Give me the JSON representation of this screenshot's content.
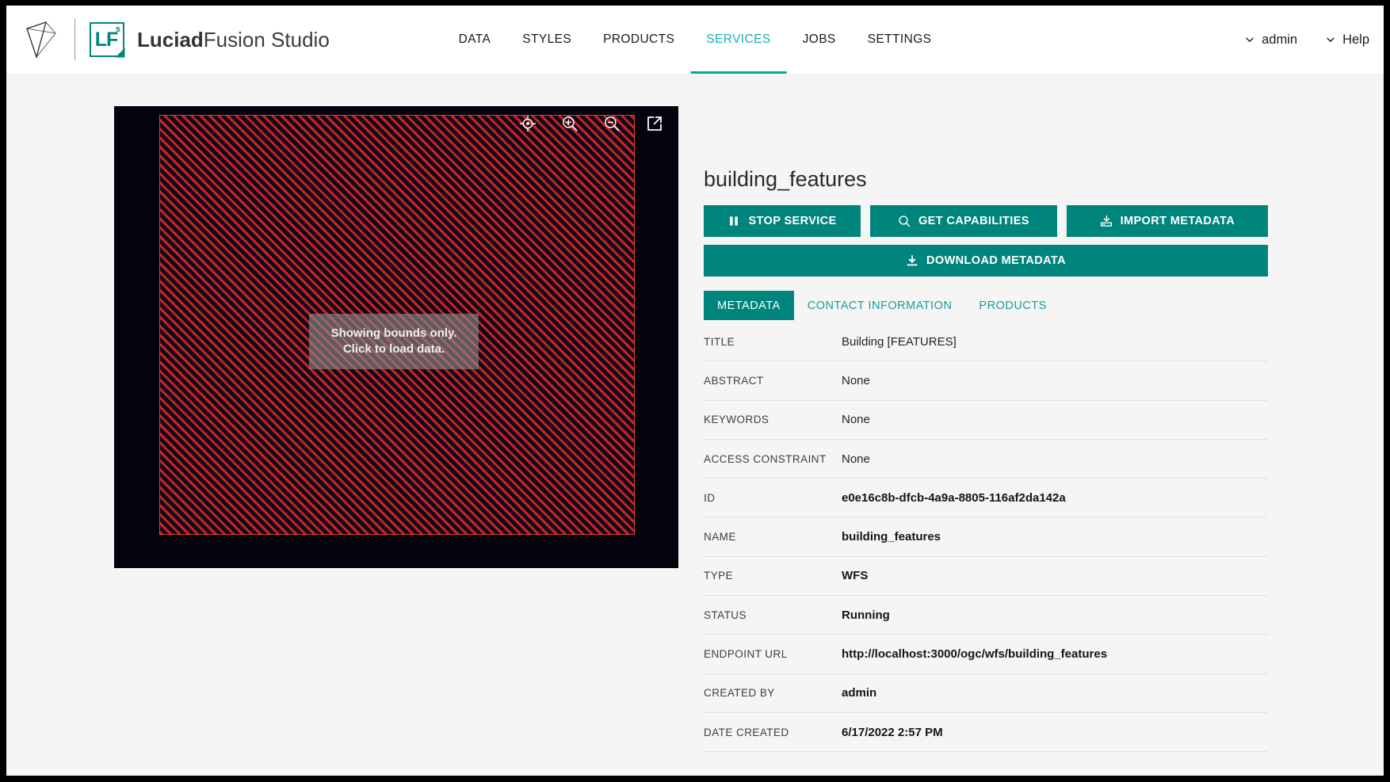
{
  "header": {
    "brand_prefix": "Luciad",
    "brand_suffix": "Fusion Studio",
    "logo_mark": "luciad-mark-icon",
    "badge_text": "LF",
    "badge_sup": "s",
    "nav": [
      {
        "label": "DATA",
        "active": false
      },
      {
        "label": "STYLES",
        "active": false
      },
      {
        "label": "PRODUCTS",
        "active": false
      },
      {
        "label": "SERVICES",
        "active": true
      },
      {
        "label": "JOBS",
        "active": false
      },
      {
        "label": "SETTINGS",
        "active": false
      }
    ],
    "user_menu": "admin",
    "help_menu": "Help"
  },
  "map": {
    "overlay_line1": "Showing bounds only.",
    "overlay_line2": "Click to load data.",
    "tools": [
      {
        "name": "fit-bounds-icon"
      },
      {
        "name": "zoom-in-icon"
      },
      {
        "name": "zoom-out-icon"
      },
      {
        "name": "open-external-icon"
      }
    ],
    "background_color": "#02030d",
    "bounds_stroke_color": "#e23b3b",
    "hatch_color": "#d32020"
  },
  "details": {
    "title": "building_features",
    "buttons": {
      "stop_service": "STOP SERVICE",
      "get_capabilities": "GET CAPABILITIES",
      "import_metadata": "IMPORT METADATA",
      "download_metadata": "DOWNLOAD METADATA"
    },
    "tabs": [
      {
        "label": "METADATA",
        "active": true
      },
      {
        "label": "CONTACT INFORMATION",
        "active": false
      },
      {
        "label": "PRODUCTS",
        "active": false
      }
    ],
    "metadata": [
      {
        "key": "TITLE",
        "value": "Building [FEATURES]",
        "bold": false
      },
      {
        "key": "ABSTRACT",
        "value": "None",
        "bold": false
      },
      {
        "key": "KEYWORDS",
        "value": "None",
        "bold": false
      },
      {
        "key": "ACCESS CONSTRAINT",
        "value": "None",
        "bold": false
      },
      {
        "key": "ID",
        "value": "e0e16c8b-dfcb-4a9a-8805-116af2da142a",
        "bold": true
      },
      {
        "key": "NAME",
        "value": "building_features",
        "bold": true
      },
      {
        "key": "TYPE",
        "value": "WFS",
        "bold": true
      },
      {
        "key": "STATUS",
        "value": "Running",
        "bold": true
      },
      {
        "key": "ENDPOINT URL",
        "value": "http://localhost:3000/ogc/wfs/building_features",
        "bold": true
      },
      {
        "key": "CREATED BY",
        "value": "admin",
        "bold": true
      },
      {
        "key": "DATE CREATED",
        "value": "6/17/2022 2:57 PM",
        "bold": true
      }
    ]
  },
  "colors": {
    "teal": "#00857d",
    "teal_accent": "#17b3b3",
    "page_bg": "#f5f5f5",
    "header_bg": "#ffffff"
  }
}
